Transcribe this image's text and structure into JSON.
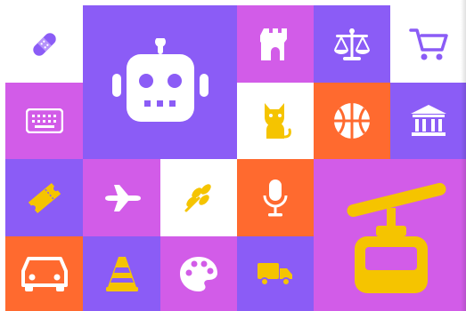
{
  "palette": {
    "white": "#ffffff",
    "purple": "#8b5cf6",
    "magenta": "#d25ce8",
    "orange": "#ff6a2f",
    "yellow": "#f5c400"
  },
  "tiles": [
    {
      "icon": "bandage-icon",
      "bg": "white"
    },
    {
      "icon": "robot-icon",
      "bg": "purple"
    },
    {
      "icon": "castle-tower-icon",
      "bg": "magenta"
    },
    {
      "icon": "scales-icon",
      "bg": "purple"
    },
    {
      "icon": "shopping-cart-icon",
      "bg": "white"
    },
    {
      "icon": "keyboard-icon",
      "bg": "magenta"
    },
    {
      "icon": "cat-icon",
      "bg": "white"
    },
    {
      "icon": "basketball-icon",
      "bg": "orange"
    },
    {
      "icon": "bank-icon",
      "bg": "purple"
    },
    {
      "icon": "ticket-icon",
      "bg": "purple"
    },
    {
      "icon": "airplane-icon",
      "bg": "magenta"
    },
    {
      "icon": "wheat-icon",
      "bg": "white"
    },
    {
      "icon": "microphone-icon",
      "bg": "orange"
    },
    {
      "icon": "cable-car-icon",
      "bg": "magenta"
    },
    {
      "icon": "car-icon",
      "bg": "orange"
    },
    {
      "icon": "traffic-cone-icon",
      "bg": "purple"
    },
    {
      "icon": "palette-icon",
      "bg": "magenta"
    },
    {
      "icon": "truck-icon",
      "bg": "purple"
    }
  ]
}
